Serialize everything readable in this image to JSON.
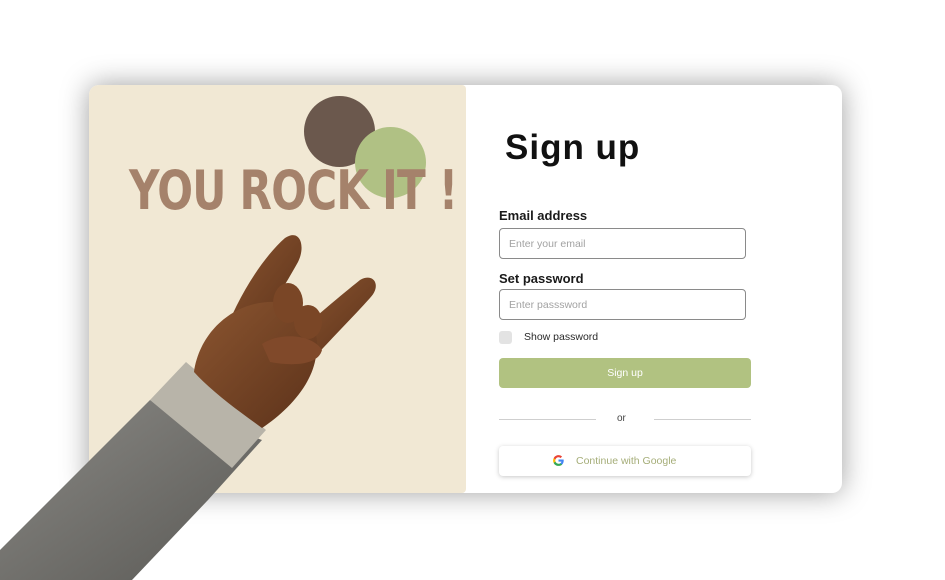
{
  "hero": {
    "headline": "YOU ROCK IT !",
    "illustration_icon": "rock-hand-gesture-icon"
  },
  "signup": {
    "title": "Sign up",
    "email_label": "Email address",
    "email_placeholder": "Enter your email",
    "email_value": "",
    "password_label": "Set password",
    "password_placeholder": "Enter passsword",
    "password_value": "",
    "show_password_label": "Show password",
    "show_password_checked": false,
    "submit_label": "Sign up",
    "divider_text": "or",
    "google_label": "Continue with Google",
    "google_icon": "google-g-icon"
  },
  "colors": {
    "hero_background": "#f1e8d4",
    "headline": "#a5826b",
    "circle_dark": "#6b584d",
    "circle_green": "#b0c184",
    "primary_button": "#b1c281",
    "google_text": "#a5ad78",
    "skin": "#6e3f22",
    "sleeve": "#6e6d69"
  }
}
